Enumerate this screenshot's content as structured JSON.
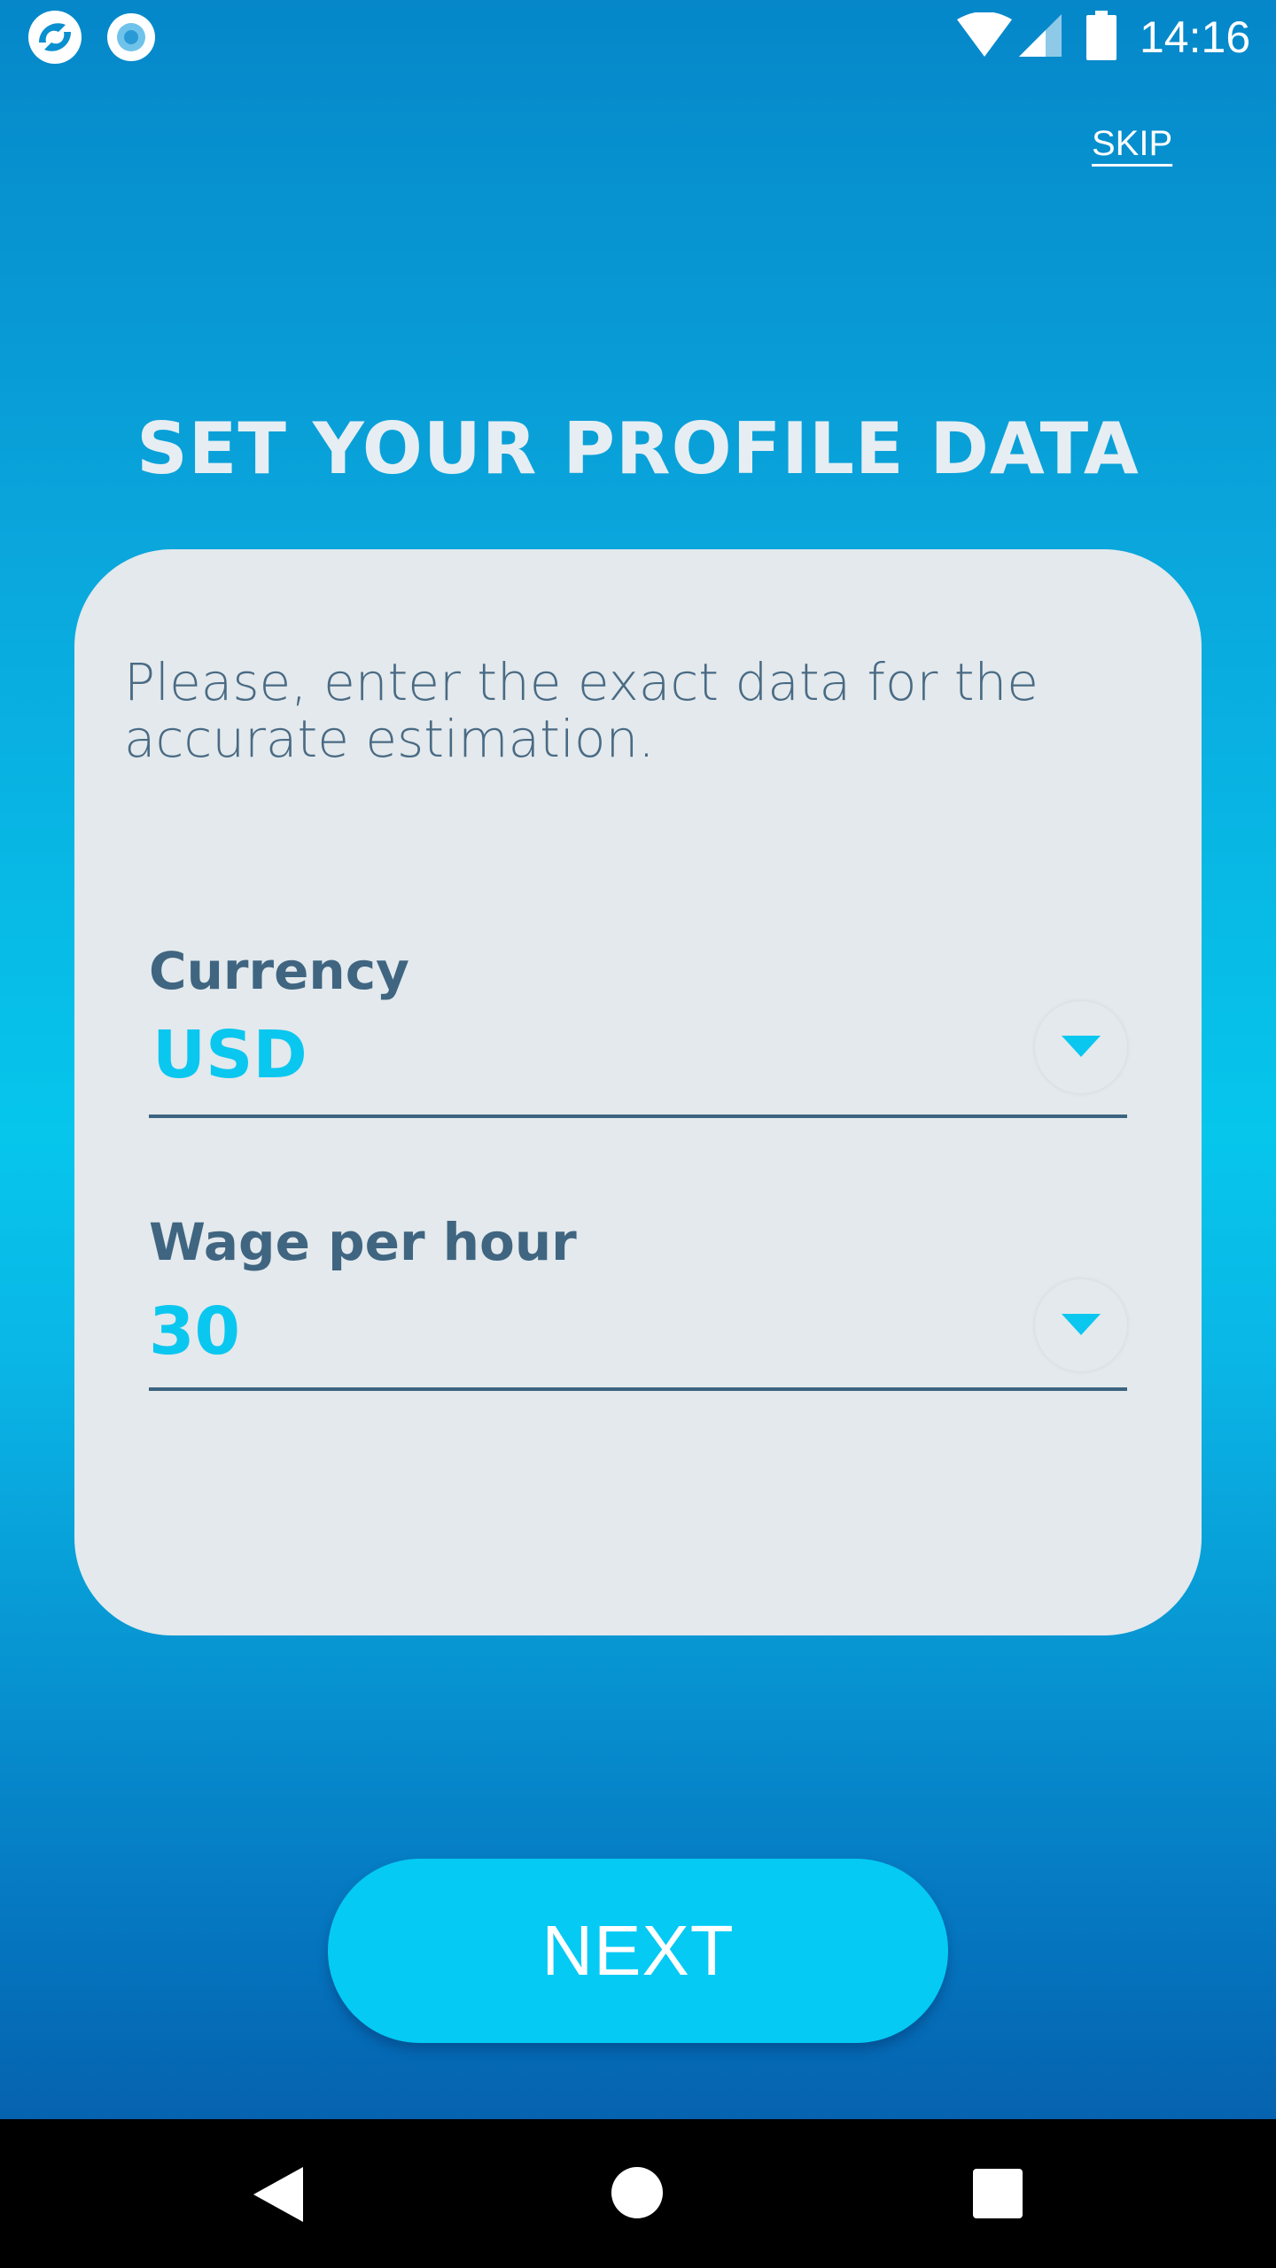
{
  "status_bar": {
    "time": "14:16",
    "icons": [
      "app-logo-icon",
      "record-icon",
      "wifi-icon",
      "signal-icon",
      "battery-icon"
    ]
  },
  "header": {
    "skip_label": "SKIP"
  },
  "main": {
    "title": "SET YOUR PROFILE DATA",
    "description": "Please, enter the exact data for the accurate estimation.",
    "fields": [
      {
        "label": "Currency",
        "value": "USD"
      },
      {
        "label": "Wage per hour",
        "value": "30"
      }
    ],
    "next_label": "NEXT"
  },
  "nav_bar": {
    "icons": [
      "back-icon",
      "home-icon",
      "recents-icon"
    ]
  },
  "colors": {
    "accent": "#04caf4",
    "label": "#3f6581",
    "card_bg": "#e3e9ec"
  }
}
